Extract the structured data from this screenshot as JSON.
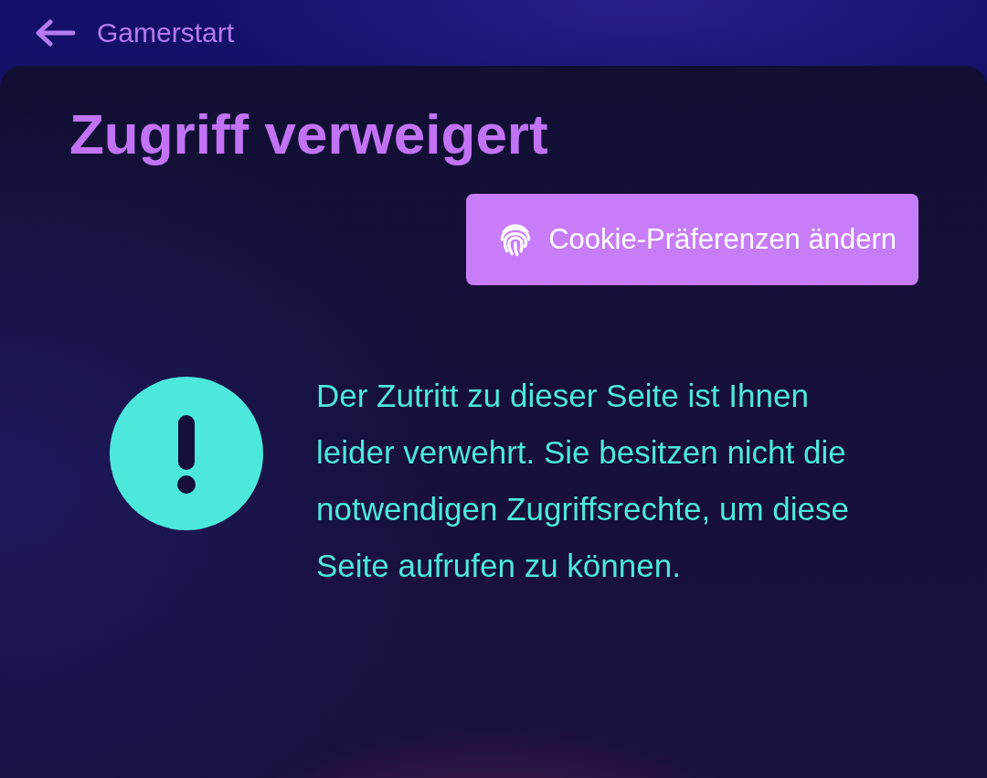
{
  "back_link": {
    "label": "Gamerstart"
  },
  "title": "Zugriff verweigert",
  "cookie_button": {
    "label": "Cookie-Präferenzen ändern"
  },
  "alert": {
    "message": "Der Zutritt zu dieser Seite ist Ihnen leider verwehrt. Sie besitzen nicht die notwendigen Zugriffsrechte, um diese Seite aufrufen zu können."
  }
}
